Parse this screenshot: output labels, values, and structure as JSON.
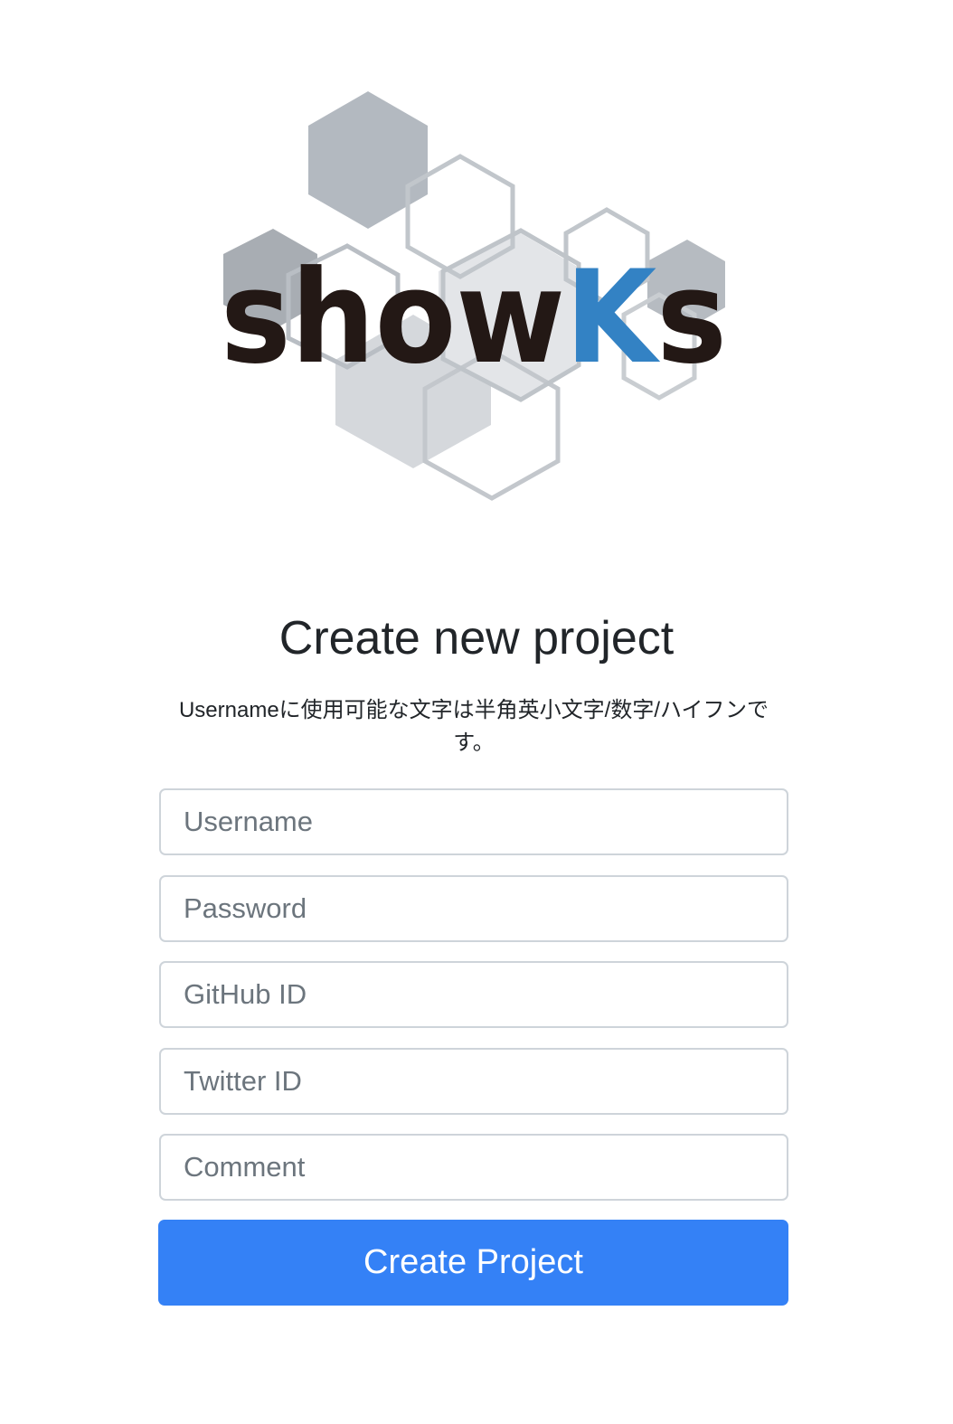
{
  "logo": {
    "text_main": "show",
    "text_accent_k": "K",
    "text_tail": "s",
    "colors": {
      "text": "#231815",
      "accent": "#3382c4",
      "hex_dark": "#a7adb4",
      "hex_light": "#d9dce0",
      "hex_outline": "#bfc4c9"
    }
  },
  "page": {
    "title": "Create new project",
    "hint": "Usernameに使用可能な文字は半角英小文字/数字/ハイフンです。"
  },
  "form": {
    "username_placeholder": "Username",
    "password_placeholder": "Password",
    "github_placeholder": "GitHub ID",
    "twitter_placeholder": "Twitter ID",
    "comment_placeholder": "Comment",
    "submit_label": "Create Project"
  },
  "colors": {
    "button_bg": "#3481f6",
    "button_text": "#ffffff",
    "border": "#ced4da",
    "placeholder": "#6c757d"
  }
}
